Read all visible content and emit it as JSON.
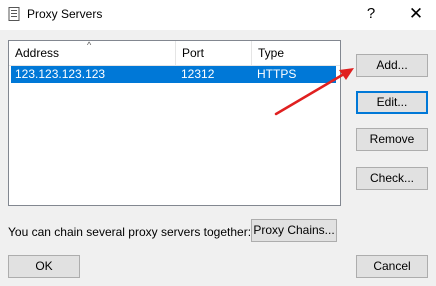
{
  "window": {
    "title": "Proxy Servers",
    "help_glyph": "?",
    "close_glyph": "✕"
  },
  "table": {
    "headers": [
      "Address",
      "Port",
      "Type"
    ],
    "sort_indicator": "^",
    "rows": [
      {
        "address": "123.123.123.123",
        "port": "12312",
        "type": "HTTPS",
        "selected": true
      }
    ]
  },
  "buttons": {
    "add": "Add...",
    "edit": "Edit...",
    "remove": "Remove",
    "check": "Check...",
    "proxy_chains": "Proxy Chains...",
    "ok": "OK",
    "cancel": "Cancel"
  },
  "chain_label": "You can chain several proxy servers together:",
  "colors": {
    "selection": "#0078d7",
    "annotation_arrow": "#e02020"
  },
  "annotation": {
    "type": "arrow",
    "target": "add-button"
  }
}
